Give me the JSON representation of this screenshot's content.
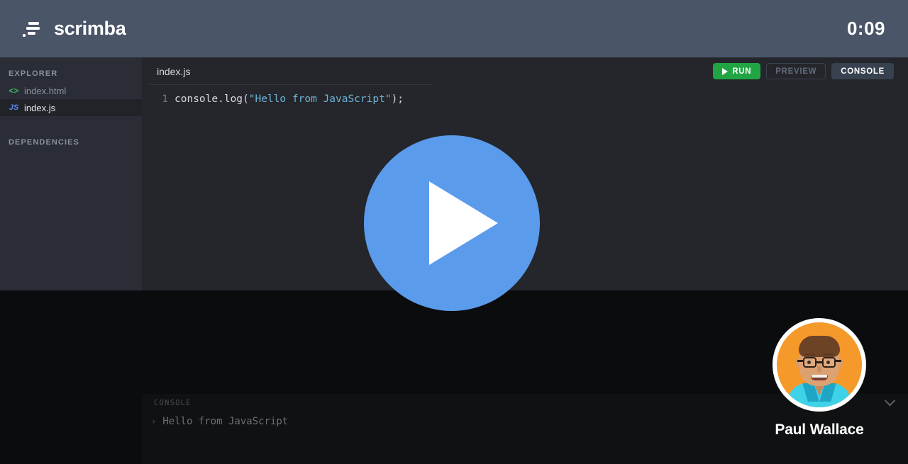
{
  "header": {
    "brand_name": "scrimba",
    "logo_icon": "scrimba-logo-icon",
    "timer": "0:09"
  },
  "sidebar": {
    "explorer_title": "EXPLORER",
    "dependencies_title": "DEPENDENCIES",
    "files": [
      {
        "name": "index.html",
        "icon": "html-file-icon",
        "icon_glyph": "<>",
        "active": false
      },
      {
        "name": "index.js",
        "icon": "js-file-icon",
        "icon_glyph": "JS",
        "active": true
      }
    ]
  },
  "editor": {
    "tab_label": "index.js",
    "toolbar": {
      "run_label": "RUN",
      "run_icon": "play-icon",
      "preview_label": "PREVIEW",
      "console_label": "CONSOLE"
    },
    "code": {
      "line_number": "1",
      "prefix": "console.log(",
      "string": "\"Hello from JavaScript\"",
      "suffix": ");"
    }
  },
  "player": {
    "play_icon": "play-button-icon"
  },
  "console": {
    "title": "CONSOLE",
    "collapse_icon": "chevron-down-icon",
    "caret": "›",
    "output": "Hello from JavaScript"
  },
  "presenter": {
    "name": "Paul Wallace",
    "avatar_icon": "presenter-avatar"
  },
  "colors": {
    "header_bg": "#4a5568",
    "sidebar_bg": "#2a2d35",
    "editor_bg": "#24262b",
    "page_bg": "#0b0c0e",
    "run_green": "#21a544",
    "console_btn": "#37414f",
    "play_blue": "#5b9bec",
    "string_blue": "#6fb4d8",
    "avatar_orange": "#f5992b"
  }
}
